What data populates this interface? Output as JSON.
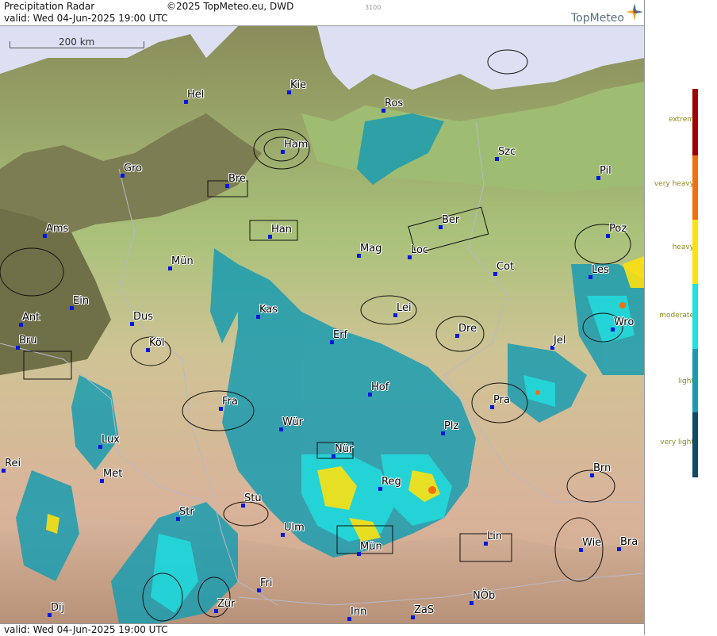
{
  "header": {
    "title": "Precipitation Radar",
    "copyright": "©2025 TopMeteo.eu, DWD",
    "code": "3100",
    "valid": "valid:  Wed  04-Jun-2025 19:00 UTC",
    "brand": "TopMeteo"
  },
  "footer": {
    "valid": "valid:  Wed  04-Jun-2025 19:00 UTC"
  },
  "scale": {
    "label": "200 km"
  },
  "legend": {
    "items": [
      {
        "label": "extrem",
        "color": "#a00000"
      },
      {
        "label": "very heavy",
        "color": "#f07010"
      },
      {
        "label": "heavy",
        "color": "#fde010"
      },
      {
        "label": "moderate",
        "color": "#20e0e0"
      },
      {
        "label": "light",
        "color": "#1a9cb0"
      },
      {
        "label": "very light",
        "color": "#0f4a66"
      }
    ]
  },
  "cities": [
    {
      "name": "Kie"
    },
    {
      "name": "Hel"
    },
    {
      "name": "Ros"
    },
    {
      "name": "Ham"
    },
    {
      "name": "Szc"
    },
    {
      "name": "Gro"
    },
    {
      "name": "Bre"
    },
    {
      "name": "Pil"
    },
    {
      "name": "Ams"
    },
    {
      "name": "Ber"
    },
    {
      "name": "Han"
    },
    {
      "name": "Poz"
    },
    {
      "name": "Mün"
    },
    {
      "name": "Mag"
    },
    {
      "name": "Loc"
    },
    {
      "name": "Cot"
    },
    {
      "name": "Les"
    },
    {
      "name": "Ein"
    },
    {
      "name": "Kas"
    },
    {
      "name": "Lei"
    },
    {
      "name": "Ant"
    },
    {
      "name": "Dus"
    },
    {
      "name": "Wro"
    },
    {
      "name": "Bru"
    },
    {
      "name": "Köl"
    },
    {
      "name": "Erf"
    },
    {
      "name": "Dre"
    },
    {
      "name": "Jel"
    },
    {
      "name": "Hof"
    },
    {
      "name": "Fra"
    },
    {
      "name": "Pra"
    },
    {
      "name": "Wür"
    },
    {
      "name": "Plz"
    },
    {
      "name": "Lux"
    },
    {
      "name": "Nür"
    },
    {
      "name": "Rei"
    },
    {
      "name": "Met"
    },
    {
      "name": "Reg"
    },
    {
      "name": "Brn"
    },
    {
      "name": "Stu"
    },
    {
      "name": "Str"
    },
    {
      "name": "Ulm"
    },
    {
      "name": "Lin"
    },
    {
      "name": "Mün"
    },
    {
      "name": "Wie"
    },
    {
      "name": "Bra"
    },
    {
      "name": "Fri"
    },
    {
      "name": "Zür"
    },
    {
      "name": "NÖb"
    },
    {
      "name": "Dij"
    },
    {
      "name": "Inn"
    },
    {
      "name": "ZaS"
    }
  ]
}
